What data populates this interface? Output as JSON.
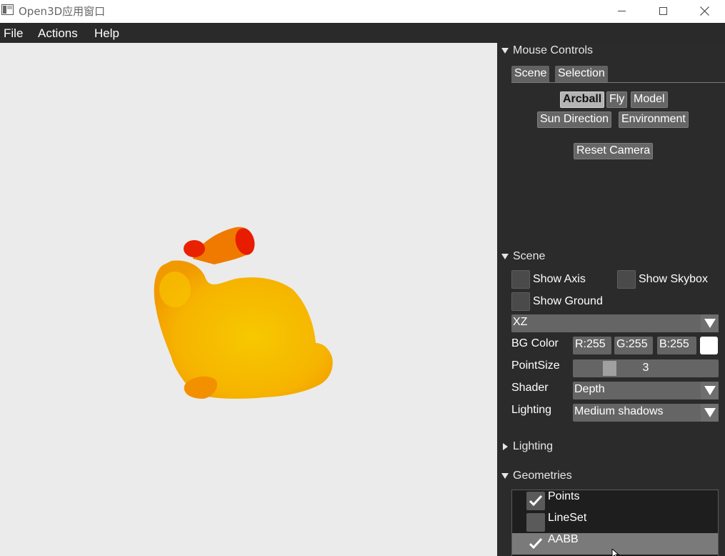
{
  "window": {
    "title": "Open3D应用窗口"
  },
  "menu": {
    "file": "File",
    "actions": "Actions",
    "help": "Help"
  },
  "panel": {
    "mouse_controls": {
      "header": "Mouse Controls",
      "tabs": [
        "Scene",
        "Selection"
      ],
      "active_tab": "Scene",
      "modes": [
        "Arcball",
        "Fly",
        "Model",
        "Sun Direction",
        "Environment"
      ],
      "active_mode": "Arcball",
      "reset_camera": "Reset Camera"
    },
    "scene": {
      "header": "Scene",
      "show_axis": "Show Axis",
      "show_axis_checked": false,
      "show_skybox": "Show Skybox",
      "show_skybox_checked": false,
      "show_ground": "Show Ground",
      "show_ground_checked": false,
      "ground_plane": "XZ",
      "bg_color_label": "BG Color",
      "bg_r": "R:255",
      "bg_g": "G:255",
      "bg_b": "B:255",
      "bg_swatch_color": "#ffffff",
      "point_size_label": "PointSize",
      "point_size_value": "3",
      "shader_label": "Shader",
      "shader_value": "Depth",
      "lighting_label": "Lighting",
      "lighting_value": "Medium shadows"
    },
    "lighting": {
      "header": "Lighting",
      "collapsed": true
    },
    "geometries": {
      "header": "Geometries",
      "items": [
        {
          "label": "Points",
          "checked": true,
          "selected": false
        },
        {
          "label": "LineSet",
          "checked": false,
          "selected": false
        },
        {
          "label": "AABB",
          "checked": true,
          "selected": true
        }
      ]
    }
  },
  "viewport": {
    "background": "#ebebeb",
    "model": "bunny-point-cloud",
    "colors": {
      "body": "#f5b800",
      "edge": "#ee8a00",
      "ears": "#e81800"
    }
  }
}
